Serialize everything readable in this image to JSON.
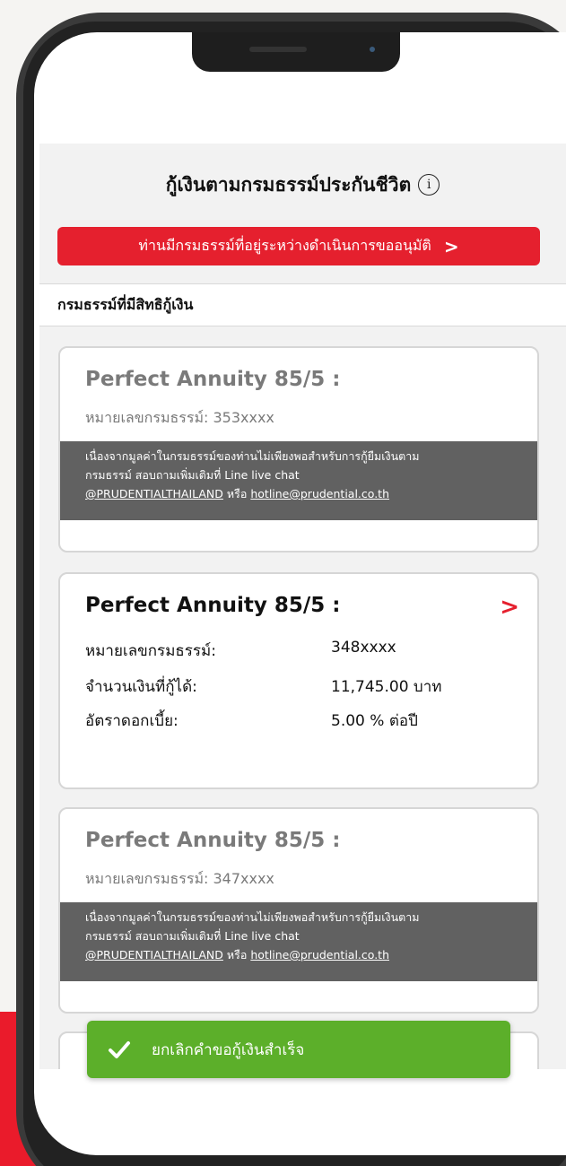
{
  "header": {
    "title": "กู้เงินตามกรมธรรม์ประกันชีวิต",
    "info_icon": "info-icon"
  },
  "pending_banner": {
    "label": "ท่านมีกรมธรรม์ที่อยู่ระหว่างดำเนินการขออนุมัติ",
    "chevron": ">"
  },
  "section": {
    "title": "กรมธรรม์ที่มีสิทธิกู้เงิน"
  },
  "policies": [
    {
      "name": "Perfect Annuity 85/5 :",
      "policy_line": "หมายเลขกรมธรรม์: 353xxxx",
      "notice_line1": "เนื่องจากมูลค่าในกรมธรรม์ของท่านไม่เพียงพอสำหรับการกู้ยืมเงินตาม",
      "notice_line2": "กรมธรรม์ สอบถามเพิ่มเติมที่ Line live chat",
      "notice_link1": "@PRUDENTIALTHAILAND",
      "notice_or": " หรือ ",
      "notice_link2": "hotline@prudential.co.th"
    },
    {
      "name": "Perfect Annuity 85/5 :",
      "chevron": ">",
      "policy_label": "หมายเลขกรมธรรม์:",
      "policy_value": "348xxxx",
      "amount_label": "จำนวนเงินที่กู้ได้:",
      "amount_value": "11,745.00 บาท",
      "rate_label": "อัตราดอกเบี้ย:",
      "rate_value": "5.00 % ต่อปี"
    },
    {
      "name": "Perfect Annuity 85/5 :",
      "policy_line": "หมายเลขกรมธรรม์: 347xxxx",
      "notice_line1": "เนื่องจากมูลค่าในกรมธรรม์ของท่านไม่เพียงพอสำหรับการกู้ยืมเงินตาม",
      "notice_line2": "กรมธรรม์ สอบถามเพิ่มเติมที่ Line live chat",
      "notice_link1": "@PRUDENTIALTHAILAND",
      "notice_or": " หรือ ",
      "notice_link2": "hotline@prudential.co.th"
    }
  ],
  "toast": {
    "message": "ยกเลิกคำขอกู้เงินสำเร็จ",
    "icon": "check-icon"
  },
  "colors": {
    "brand_red": "#e5202e",
    "success_green": "#5caf2a",
    "notice_gray": "#616161"
  }
}
